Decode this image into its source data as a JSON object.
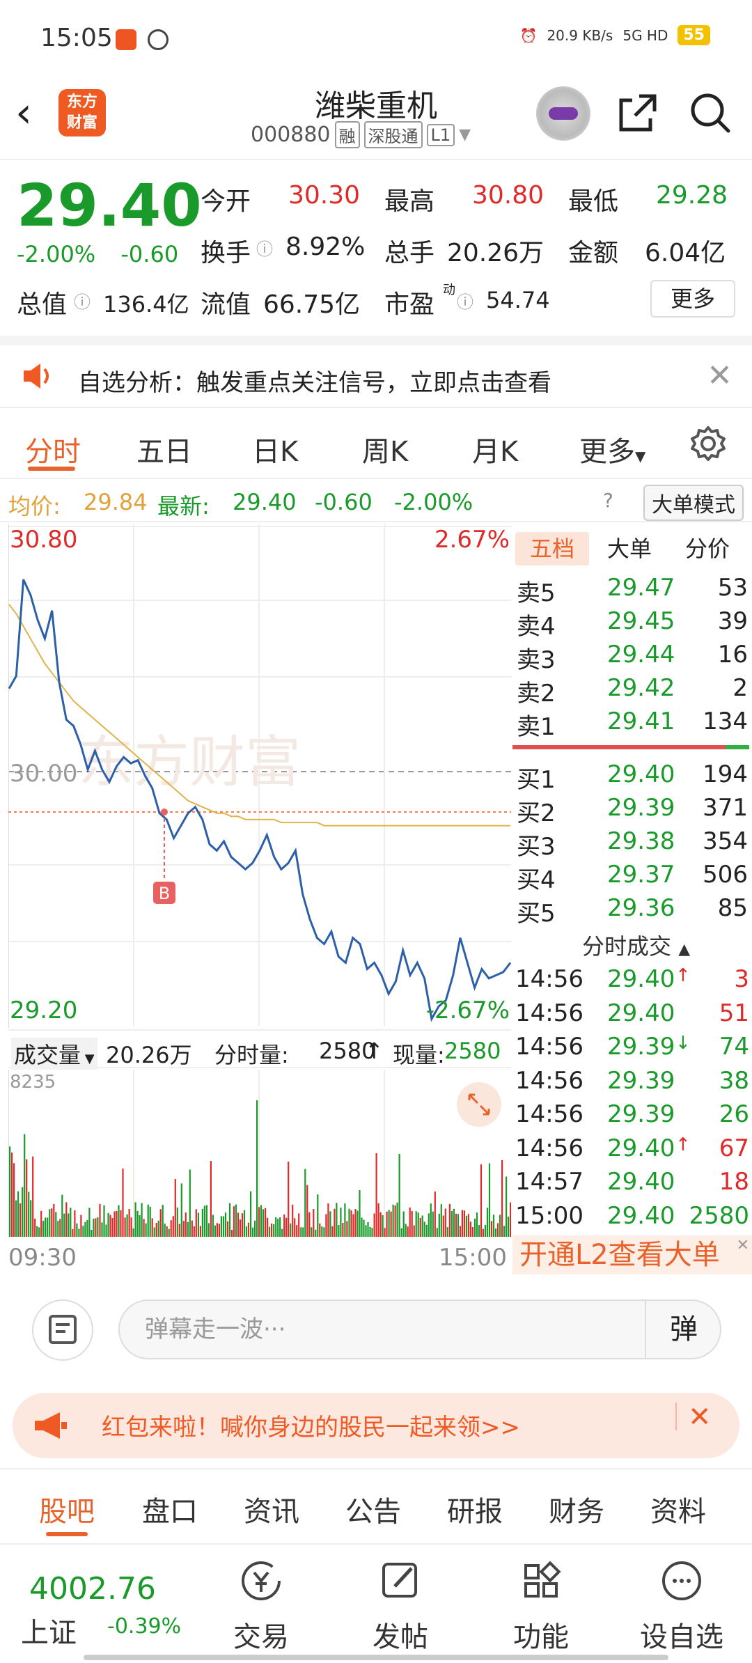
{
  "status": {
    "time": "15:05",
    "net_speed": "20.9 KB/s",
    "signal": "5G HD",
    "battery": "55"
  },
  "header": {
    "title": "潍柴重机",
    "code": "000880",
    "tags": [
      "融",
      "深股通",
      "L1"
    ]
  },
  "quote": {
    "price": "29.40",
    "change_pct": "-2.00%",
    "change": "-0.60",
    "open_label": "今开",
    "open": "30.30",
    "high_label": "最高",
    "high": "30.80",
    "low_label": "最低",
    "low": "29.28",
    "turnover_label": "换手",
    "turnover": "8.92%",
    "volume_label": "总手",
    "volume": "20.26万",
    "amount_label": "金额",
    "amount": "6.04亿",
    "mktcap_label": "总值",
    "mktcap": "136.4亿",
    "float_label": "流值",
    "float": "66.75亿",
    "pe_label": "市盈",
    "pe_sup": "动",
    "pe": "54.74",
    "more": "更多"
  },
  "banner": {
    "text": "自选分析：触发重点关注信号，立即点击查看"
  },
  "tabs": {
    "items": [
      "分时",
      "五日",
      "日K",
      "周K",
      "月K",
      "更多"
    ],
    "active": 0
  },
  "avgline": {
    "avg_label": "均价:",
    "avg": "29.84",
    "last_label": "最新:",
    "last": "29.40",
    "chg": "-0.60",
    "pct": "-2.00%",
    "big_mode": "大单模式"
  },
  "chart_data": {
    "type": "line",
    "title": "",
    "y_top_label": "30.80",
    "y_mid_label": "30.00",
    "y_bot_label": "29.20",
    "pct_top_label": "2.67%",
    "pct_bot_label": "-2.67%",
    "ylim": [
      29.2,
      30.8
    ],
    "x_start_label": "09:30",
    "x_end_label": "15:00",
    "marker": "B",
    "series": [
      {
        "name": "",
        "color": "#2d5fa8",
        "values": [
          30.28,
          30.32,
          30.63,
          30.58,
          30.5,
          30.44,
          30.53,
          30.3,
          30.18,
          30.16,
          30.1,
          30.02,
          30.08,
          30.02,
          29.98,
          30.03,
          30.06,
          30.04,
          30.05,
          30.0,
          29.96,
          29.88,
          29.86,
          29.8,
          29.84,
          29.88,
          29.9,
          29.86,
          29.78,
          29.76,
          29.79,
          29.74,
          29.72,
          29.7,
          29.72,
          29.76,
          29.81,
          29.74,
          29.7,
          29.72,
          29.76,
          29.62,
          29.54,
          29.48,
          29.46,
          29.5,
          29.42,
          29.4,
          29.48,
          29.46,
          29.38,
          29.4,
          29.36,
          29.3,
          29.34,
          29.44,
          29.36,
          29.4,
          29.35,
          29.22,
          29.26,
          29.28,
          29.36,
          29.48,
          29.4,
          29.32,
          29.38,
          29.35,
          29.36,
          29.37,
          29.4
        ]
      },
      {
        "name": "",
        "color": "#e2b24a",
        "values": [
          30.55,
          30.52,
          30.48,
          30.44,
          30.4,
          30.36,
          30.33,
          30.3,
          30.27,
          30.24,
          30.22,
          30.2,
          30.18,
          30.16,
          30.14,
          30.12,
          30.1,
          30.08,
          30.06,
          30.04,
          30.02,
          30.0,
          29.98,
          29.96,
          29.94,
          29.92,
          29.91,
          29.9,
          29.89,
          29.88,
          29.88,
          29.87,
          29.87,
          29.86,
          29.86,
          29.86,
          29.86,
          29.86,
          29.85,
          29.85,
          29.85,
          29.85,
          29.85,
          29.85,
          29.84,
          29.84,
          29.84,
          29.84,
          29.84,
          29.84,
          29.84,
          29.84,
          29.84,
          29.84,
          29.84,
          29.84,
          29.84,
          29.84,
          29.84,
          29.84,
          29.84,
          29.84,
          29.84,
          29.84,
          29.84,
          29.84,
          29.84,
          29.84,
          29.84,
          29.84,
          29.84
        ]
      }
    ],
    "volume": {
      "max_label": "8235",
      "label": "成交量",
      "total": "20.26万",
      "period_label": "分时量:",
      "period": "2580",
      "now_label": "现量:",
      "now": "2580"
    }
  },
  "orderbook": {
    "tabs": [
      "五档",
      "大单",
      "分价"
    ],
    "asks": [
      {
        "label": "卖5",
        "price": "29.47",
        "vol": "53"
      },
      {
        "label": "卖4",
        "price": "29.45",
        "vol": "39"
      },
      {
        "label": "卖3",
        "price": "29.44",
        "vol": "16"
      },
      {
        "label": "卖2",
        "price": "29.42",
        "vol": "2"
      },
      {
        "label": "卖1",
        "price": "29.41",
        "vol": "134"
      }
    ],
    "bids": [
      {
        "label": "买1",
        "price": "29.40",
        "vol": "194"
      },
      {
        "label": "买2",
        "price": "29.39",
        "vol": "371"
      },
      {
        "label": "买3",
        "price": "29.38",
        "vol": "354"
      },
      {
        "label": "买4",
        "price": "29.37",
        "vol": "506"
      },
      {
        "label": "买5",
        "price": "29.36",
        "vol": "85"
      }
    ]
  },
  "ticks": {
    "header": "分时成交",
    "rows": [
      {
        "time": "14:56",
        "price": "29.40",
        "dir": "↑",
        "vol": "3",
        "color": "red"
      },
      {
        "time": "14:56",
        "price": "29.40",
        "dir": "",
        "vol": "51",
        "color": "red"
      },
      {
        "time": "14:56",
        "price": "29.39",
        "dir": "↓",
        "vol": "74",
        "color": "green"
      },
      {
        "time": "14:56",
        "price": "29.39",
        "dir": "",
        "vol": "38",
        "color": "green"
      },
      {
        "time": "14:56",
        "price": "29.39",
        "dir": "",
        "vol": "26",
        "color": "green"
      },
      {
        "time": "14:56",
        "price": "29.40",
        "dir": "↑",
        "vol": "67",
        "color": "red"
      },
      {
        "time": "14:57",
        "price": "29.40",
        "dir": "",
        "vol": "18",
        "color": "red"
      },
      {
        "time": "15:00",
        "price": "29.40",
        "dir": "",
        "vol": "2580",
        "color": "green"
      }
    ],
    "l2_promo": "开通L2查看大单"
  },
  "comment": {
    "placeholder": "弹幕走一波···",
    "danmu_btn": "弹"
  },
  "redpack": {
    "text": "红包来啦！喊你身边的股民一起来领>>"
  },
  "bottom_tabs": {
    "items": [
      "股吧",
      "盘口",
      "资讯",
      "公告",
      "研报",
      "财务",
      "资料"
    ],
    "active": 0
  },
  "nav": {
    "index_value": "4002.76",
    "index_name": "上证",
    "index_chg": "-0.39%",
    "items": [
      {
        "label": "交易",
        "icon": "yen-cycle-icon"
      },
      {
        "label": "发帖",
        "icon": "edit-icon"
      },
      {
        "label": "功能",
        "icon": "grid-icon"
      },
      {
        "label": "设自选",
        "icon": "more-dots-icon"
      }
    ]
  }
}
